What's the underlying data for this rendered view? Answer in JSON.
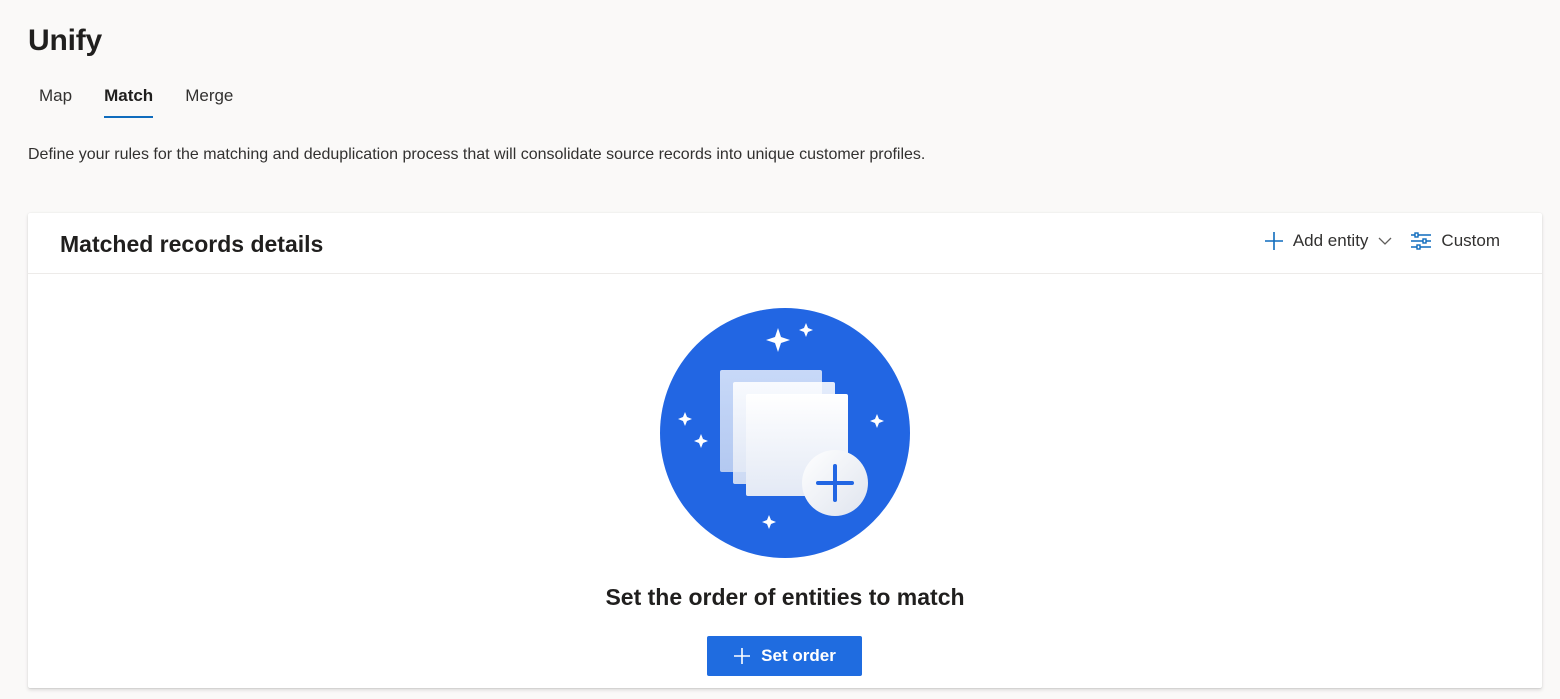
{
  "page": {
    "title": "Unify"
  },
  "tabs": [
    {
      "label": "Map"
    },
    {
      "label": "Match",
      "active": true
    },
    {
      "label": "Merge"
    }
  ],
  "description": "Define your rules for the matching and deduplication process that will consolidate source records into unique customer profiles.",
  "card": {
    "title": "Matched records details",
    "actions": {
      "add_entity_label": "Add entity",
      "custom_label": "Custom"
    },
    "empty_state": {
      "title": "Set the order of entities to match",
      "button_label": "Set order"
    }
  },
  "icons": {
    "add": "plus-icon",
    "dropdown": "chevron-down-icon",
    "custom": "sliders-icon",
    "illustration": "documents-plus-illustration"
  },
  "colors": {
    "accent": "#0f6cbd",
    "primary_button": "#1f6ce0",
    "illustration_circle": "#2266e3"
  }
}
